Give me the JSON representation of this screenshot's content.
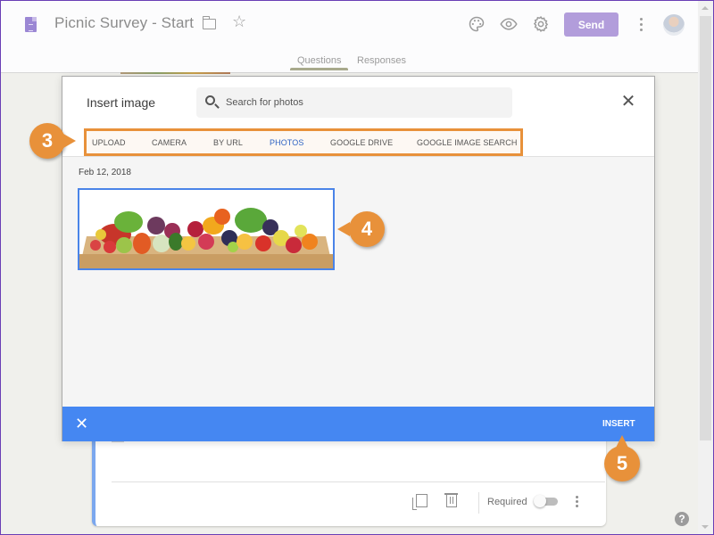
{
  "app": {
    "title": "Picnic Survey - Start",
    "send_label": "Send",
    "tabs": [
      {
        "label": "Questions",
        "active": true
      },
      {
        "label": "Responses",
        "active": false
      }
    ],
    "help_glyph": "?"
  },
  "dialog": {
    "title": "Insert image",
    "search_placeholder": "Search for photos",
    "close_glyph": "✕",
    "tabs": [
      {
        "label": "UPLOAD",
        "active": false
      },
      {
        "label": "CAMERA",
        "active": false
      },
      {
        "label": "BY URL",
        "active": false
      },
      {
        "label": "PHOTOS",
        "active": true
      },
      {
        "label": "GOOGLE DRIVE",
        "active": false
      },
      {
        "label": "GOOGLE IMAGE SEARCH",
        "active": false
      }
    ],
    "date_label": "Feb 12, 2018",
    "photo": {
      "description": "Assorted fruits and vegetables on a wooden table",
      "selected": true
    },
    "footer_close_glyph": "✕",
    "insert_label": "INSERT"
  },
  "question_card": {
    "required_label": "Required",
    "required_on": false
  },
  "callouts": [
    "3",
    "4",
    "5"
  ],
  "colors": {
    "accent_purple": "#b29ddb",
    "dialog_blue": "#4587f2",
    "active_tab": "#2f64c4",
    "callout_orange": "#e8913a",
    "selection_border": "#4a84e8"
  }
}
